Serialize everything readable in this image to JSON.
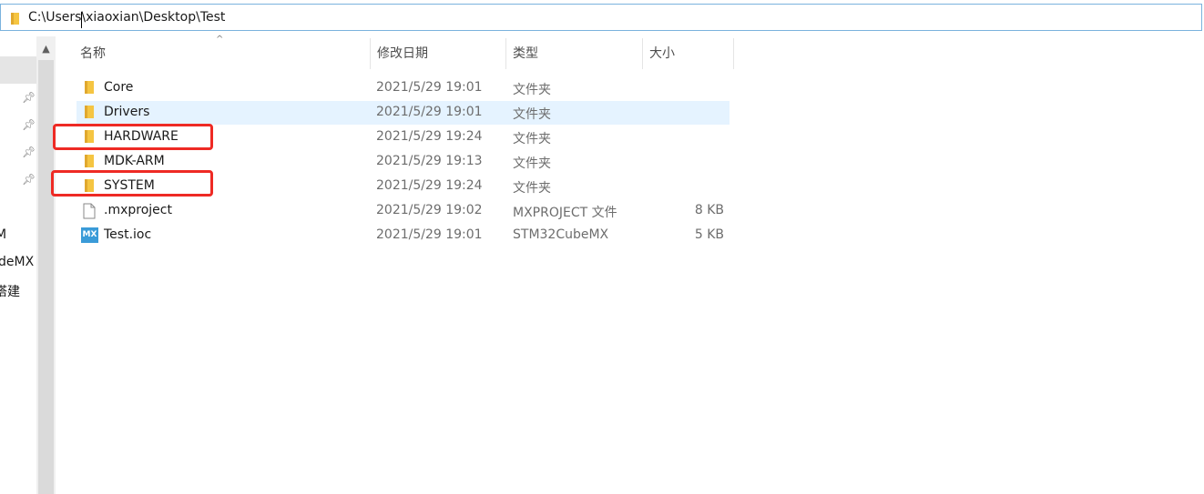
{
  "address_bar": {
    "path": "C:\\Users\\xiaoxian\\Desktop\\Test"
  },
  "nav_pane": {
    "items": [
      {
        "label": "M"
      },
      {
        "label": "deMX"
      },
      {
        "label": "搭建"
      }
    ]
  },
  "columns": {
    "name": "名称",
    "date": "修改日期",
    "type": "类型",
    "size": "大小"
  },
  "files": [
    {
      "name": "Core",
      "date": "2021/5/29 19:01",
      "type": "文件夹",
      "size": "",
      "icon": "folder-icon"
    },
    {
      "name": "Drivers",
      "date": "2021/5/29 19:01",
      "type": "文件夹",
      "size": "",
      "icon": "folder-icon"
    },
    {
      "name": "HARDWARE",
      "date": "2021/5/29 19:24",
      "type": "文件夹",
      "size": "",
      "icon": "folder-icon"
    },
    {
      "name": "MDK-ARM",
      "date": "2021/5/29 19:13",
      "type": "文件夹",
      "size": "",
      "icon": "folder-icon"
    },
    {
      "name": "SYSTEM",
      "date": "2021/5/29 19:24",
      "type": "文件夹",
      "size": "",
      "icon": "folder-icon"
    },
    {
      "name": ".mxproject",
      "date": "2021/5/29 19:02",
      "type": "MXPROJECT 文件",
      "size": "8 KB",
      "icon": "file-icon"
    },
    {
      "name": "Test.ioc",
      "date": "2021/5/29 19:01",
      "type": "STM32CubeMX",
      "size": "5 KB",
      "icon": "mx-icon",
      "icon_text": "MX"
    }
  ],
  "colors": {
    "highlight": "#ee2a24",
    "hover_row": "#e5f3ff",
    "folder": "#f5c542",
    "mx_icon": "#3a9bd8"
  }
}
